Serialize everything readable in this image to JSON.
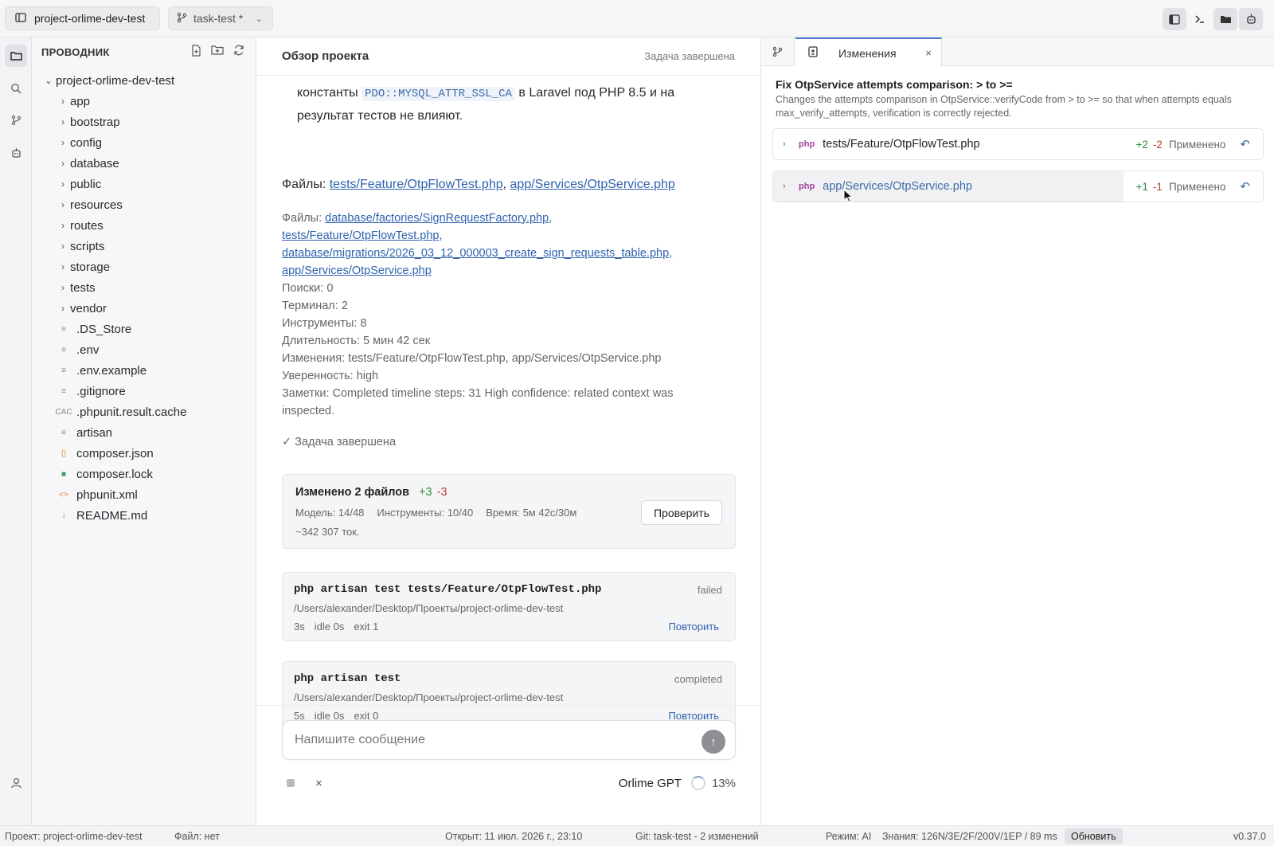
{
  "titlebar": {
    "project": "project-orlime-dev-test",
    "branch": "task-test *"
  },
  "explorer": {
    "title": "ПРОВОДНИК",
    "root": "project-orlime-dev-test",
    "folders": [
      "app",
      "bootstrap",
      "config",
      "database",
      "public",
      "resources",
      "routes",
      "scripts",
      "storage",
      "tests",
      "vendor"
    ],
    "files": [
      {
        "name": ".DS_Store",
        "icon": "≡"
      },
      {
        "name": ".env",
        "icon": "≡"
      },
      {
        "name": ".env.example",
        "icon": "≡"
      },
      {
        "name": ".gitignore",
        "icon": "≡"
      },
      {
        "name": ".phpunit.result.cache",
        "icon": "CAC"
      },
      {
        "name": "artisan",
        "icon": "≡"
      },
      {
        "name": "composer.json",
        "icon": "{}"
      },
      {
        "name": "composer.lock",
        "icon": "■"
      },
      {
        "name": "phpunit.xml",
        "icon": "<>"
      },
      {
        "name": "README.md",
        "icon": "↓"
      }
    ]
  },
  "center": {
    "title": "Обзор проекта",
    "status": "Задача завершена",
    "para_prefix": "константы",
    "para_code": "PDO::MYSQL_ATTR_SSL_CA",
    "para_suffix": "в Laravel под PHP 8.5 и на",
    "para_line2": "результат тестов не влияют.",
    "files_label": "Файлы:",
    "files_link1": "tests/Feature/OtpFlowTest.php",
    "files_sep": ",",
    "files_link2": "app/Services/OtpService.php",
    "meta_files_label": "Файлы:",
    "meta_link1": "database/factories/SignRequestFactory.php,",
    "meta_link2": "tests/Feature/OtpFlowTest.php,",
    "meta_link3": "database/migrations/2026_03_12_000003_create_sign_requests_table.php,",
    "meta_link4": "app/Services/OtpService.php",
    "meta_lines": [
      "Поиски: 0",
      "Терминал: 2",
      "Инструменты: 8",
      "Длительность: 5 мин 42 сек",
      "Изменения: tests/Feature/OtpFlowTest.php, app/Services/OtpService.php",
      "Уверенность: high",
      "Заметки: Completed timeline steps: 31 High confidence: related context was",
      "inspected."
    ],
    "done": "✓ Задача завершена",
    "summary": {
      "title": "Изменено 2 файлов",
      "plus": "+3",
      "minus": "-3",
      "model": "Модель: 14/48",
      "tools": "Инструменты: 10/40",
      "time": "Время: 5м 42с/30м",
      "tokens": "~342 307 ток.",
      "button": "Проверить"
    },
    "commands": [
      {
        "name": "php artisan test tests/Feature/OtpFlowTest.php",
        "status": "failed",
        "path": "/Users/alexander/Desktop/Проекты/project-orlime-dev-test",
        "time": "3s",
        "idle": "idle 0s",
        "exit": "exit 1",
        "retry": "Повторить"
      },
      {
        "name": "php artisan test",
        "status": "completed",
        "path": "/Users/alexander/Desktop/Проекты/project-orlime-dev-test",
        "time": "5s",
        "idle": "idle 0s",
        "exit": "exit 0",
        "retry": "Повторить"
      }
    ],
    "composer_placeholder": "Напишите сообщение",
    "cancel": "×",
    "model_name": "Orlime GPT",
    "context_pct": "13%"
  },
  "right": {
    "tab_label": "Изменения",
    "tab_close": "×",
    "commit_title": "Fix OtpService attempts comparison: > to >=",
    "commit_desc": "Changes the attempts comparison in OtpService::verifyCode from > to >= so that when attempts equals max_verify_attempts, verification is correctly rejected.",
    "files": [
      {
        "lang": "php",
        "name": "tests/Feature/OtpFlowTest.php",
        "adds": "+2",
        "dels": "-2",
        "state": "Применено"
      },
      {
        "lang": "php",
        "name": "app/Services/OtpService.php",
        "adds": "+1",
        "dels": "-1",
        "state": "Применено"
      }
    ]
  },
  "statusbar": {
    "project": "Проект: project-orlime-dev-test",
    "file": "Файл: нет",
    "opened": "Открыт: 11 июл. 2026 г., 23:10",
    "git": "Git: task-test - 2 изменений",
    "mode": "Режим: AI",
    "knowledge": "Знания: 126N/3E/2F/200V/1EP / 89 ms",
    "refresh": "Обновить",
    "version": "v0.37.0"
  },
  "colors": {
    "accent": "#4a7bd0",
    "link": "#2f62b0",
    "added": "#2f8a3a",
    "removed": "#c0392b"
  }
}
